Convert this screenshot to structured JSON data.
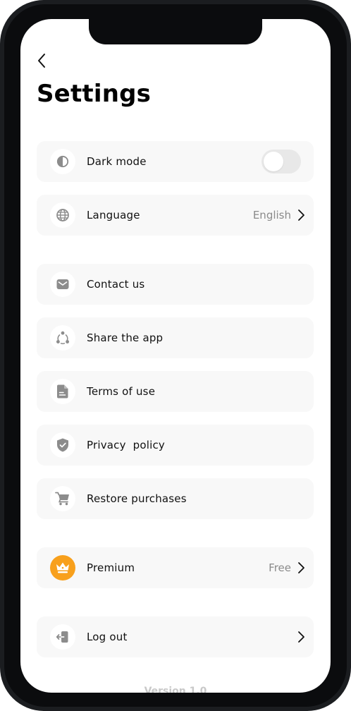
{
  "page": {
    "title": "Settings"
  },
  "settings_group": [
    {
      "id": "dark_mode",
      "label": "Dark mode",
      "icon": "contrast-icon",
      "toggle": false
    },
    {
      "id": "language",
      "label": "Language",
      "icon": "globe-icon",
      "value": "English"
    }
  ],
  "support_group": [
    {
      "id": "contact",
      "label": "Contact us",
      "icon": "mail-icon"
    },
    {
      "id": "share",
      "label": "Share the app",
      "icon": "share-icon"
    },
    {
      "id": "terms",
      "label": "Terms of use",
      "icon": "document-icon"
    },
    {
      "id": "privacy",
      "label": "Privacy  policy",
      "icon": "shield-check-icon"
    },
    {
      "id": "restore",
      "label": "Restore purchases",
      "icon": "cart-icon"
    }
  ],
  "premium": {
    "label": "Premium",
    "value": "Free",
    "icon": "crown-icon",
    "accent_color": "#f8a01c"
  },
  "logout": {
    "label": "Log out",
    "icon": "logout-icon"
  },
  "footer": {
    "version": "Version 1.0"
  }
}
